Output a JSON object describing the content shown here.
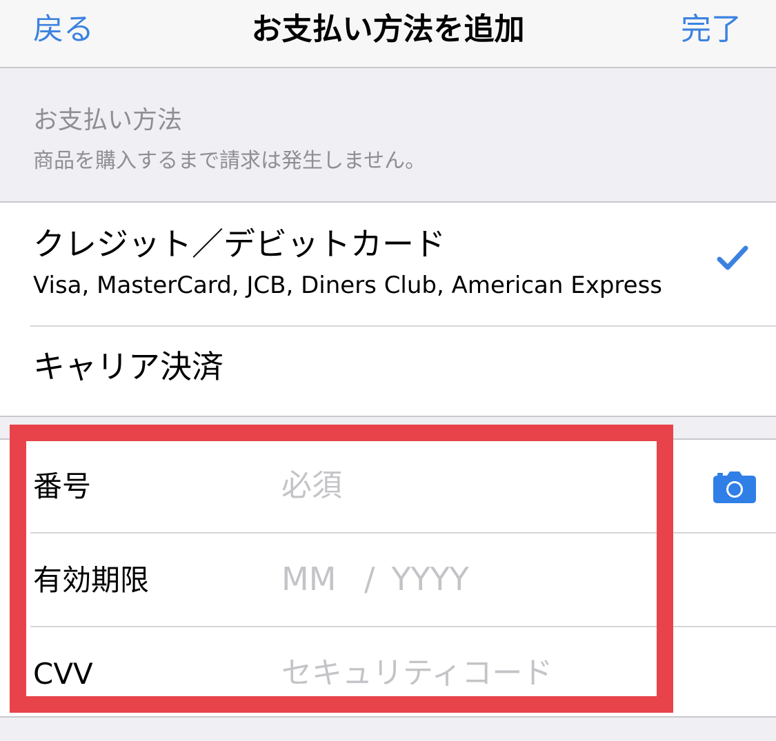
{
  "navbar": {
    "back_label": "戻る",
    "title": "お支払い方法を追加",
    "done_label": "完了"
  },
  "section": {
    "title": "お支払い方法",
    "subtitle": "商品を購入するまで請求は発生しません。"
  },
  "methods": {
    "card": {
      "title": "クレジット／デビットカード",
      "subtitle": "Visa, MasterCard, JCB, Diners Club, American Express",
      "selected": true,
      "icon": "checkmark-icon"
    },
    "carrier": {
      "title": "キャリア決済"
    }
  },
  "form": {
    "number": {
      "label": "番号",
      "placeholder": "必須",
      "icon": "camera-icon"
    },
    "expiry": {
      "label": "有効期限",
      "mm_placeholder": "MM",
      "separator": "/",
      "yyyy_placeholder": "YYYY"
    },
    "cvv": {
      "label": "CVV",
      "placeholder": "セキュリティコード"
    }
  },
  "colors": {
    "accent": "#3b82e0",
    "highlight": "#e8434a",
    "placeholder": "#c4c4c8",
    "secondary_text": "#8e8e93",
    "background": "#efeff4"
  }
}
